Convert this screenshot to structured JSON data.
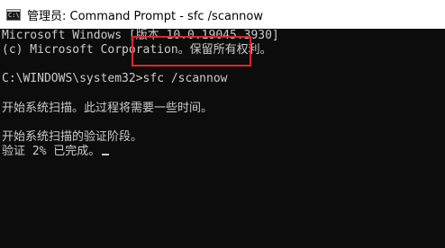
{
  "window": {
    "title": "管理员: Command Prompt - sfc  /scannow",
    "icon": "cmd-icon"
  },
  "console": {
    "line1": "Microsoft Windows [版本 10.0.19045.3930]",
    "line2": "(c) Microsoft Corporation。保留所有权利。",
    "prompt": "C:\\WINDOWS\\system32>",
    "command": "sfc /scannow",
    "line4": "开始系统扫描。此过程将需要一些时间。",
    "line5": "开始系统扫描的验证阶段。",
    "line6": "验证 2% 已完成。"
  },
  "colors": {
    "console_bg": "#0c0c0c",
    "console_text": "#cccccc",
    "highlight": "#e0262a",
    "titlebar_bg": "#ffffff"
  }
}
